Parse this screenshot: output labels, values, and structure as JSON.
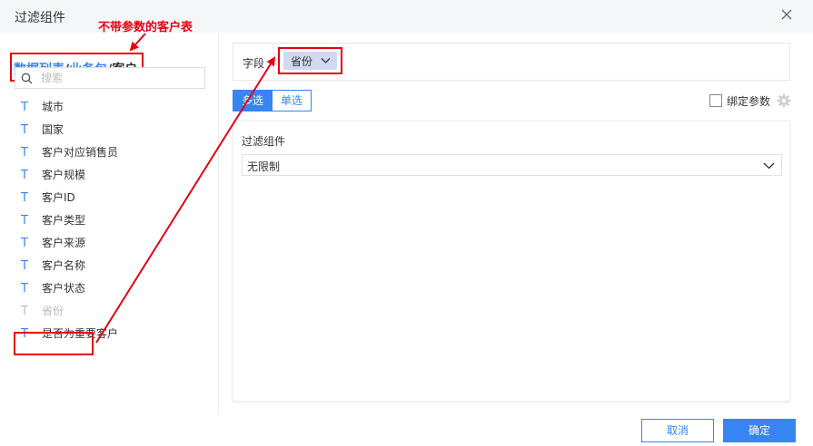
{
  "dialog": {
    "title": "过滤组件"
  },
  "annotation": {
    "text": "不带参数的客户表"
  },
  "breadcrumb": {
    "part1": "数据列表",
    "sep1": "/",
    "part2": "业务包",
    "sep2": "/",
    "current": "客户"
  },
  "search": {
    "placeholder": "搜索",
    "value": ""
  },
  "field_list": [
    {
      "type": "T",
      "label": "城市"
    },
    {
      "type": "T",
      "label": "国家"
    },
    {
      "type": "T",
      "label": "客户对应销售员"
    },
    {
      "type": "T",
      "label": "客户规模"
    },
    {
      "type": "T",
      "label": "客户ID"
    },
    {
      "type": "T",
      "label": "客户类型"
    },
    {
      "type": "T",
      "label": "客户来源"
    },
    {
      "type": "T",
      "label": "客户名称"
    },
    {
      "type": "T",
      "label": "客户状态"
    },
    {
      "type": "T",
      "label": "省份",
      "disabled": true
    },
    {
      "type": "T",
      "label": "是否为重要客户"
    }
  ],
  "field_row": {
    "label": "字段",
    "tag": "省份"
  },
  "mode": {
    "multi": "多选",
    "single": "单选",
    "selected": "multi"
  },
  "bind_param": {
    "label": "绑定参数",
    "checked": false
  },
  "filter_panel": {
    "title": "过滤组件",
    "select_value": "无限制"
  },
  "footer": {
    "cancel": "取消",
    "ok": "确定"
  },
  "colors": {
    "accent": "#3685f2",
    "annotation_red": "#e60012",
    "tag_bg": "#cfd9f0"
  },
  "icons": {
    "close": "close-icon",
    "search": "search-icon",
    "chevron": "chevron-down-icon",
    "gear": "gear-icon"
  }
}
